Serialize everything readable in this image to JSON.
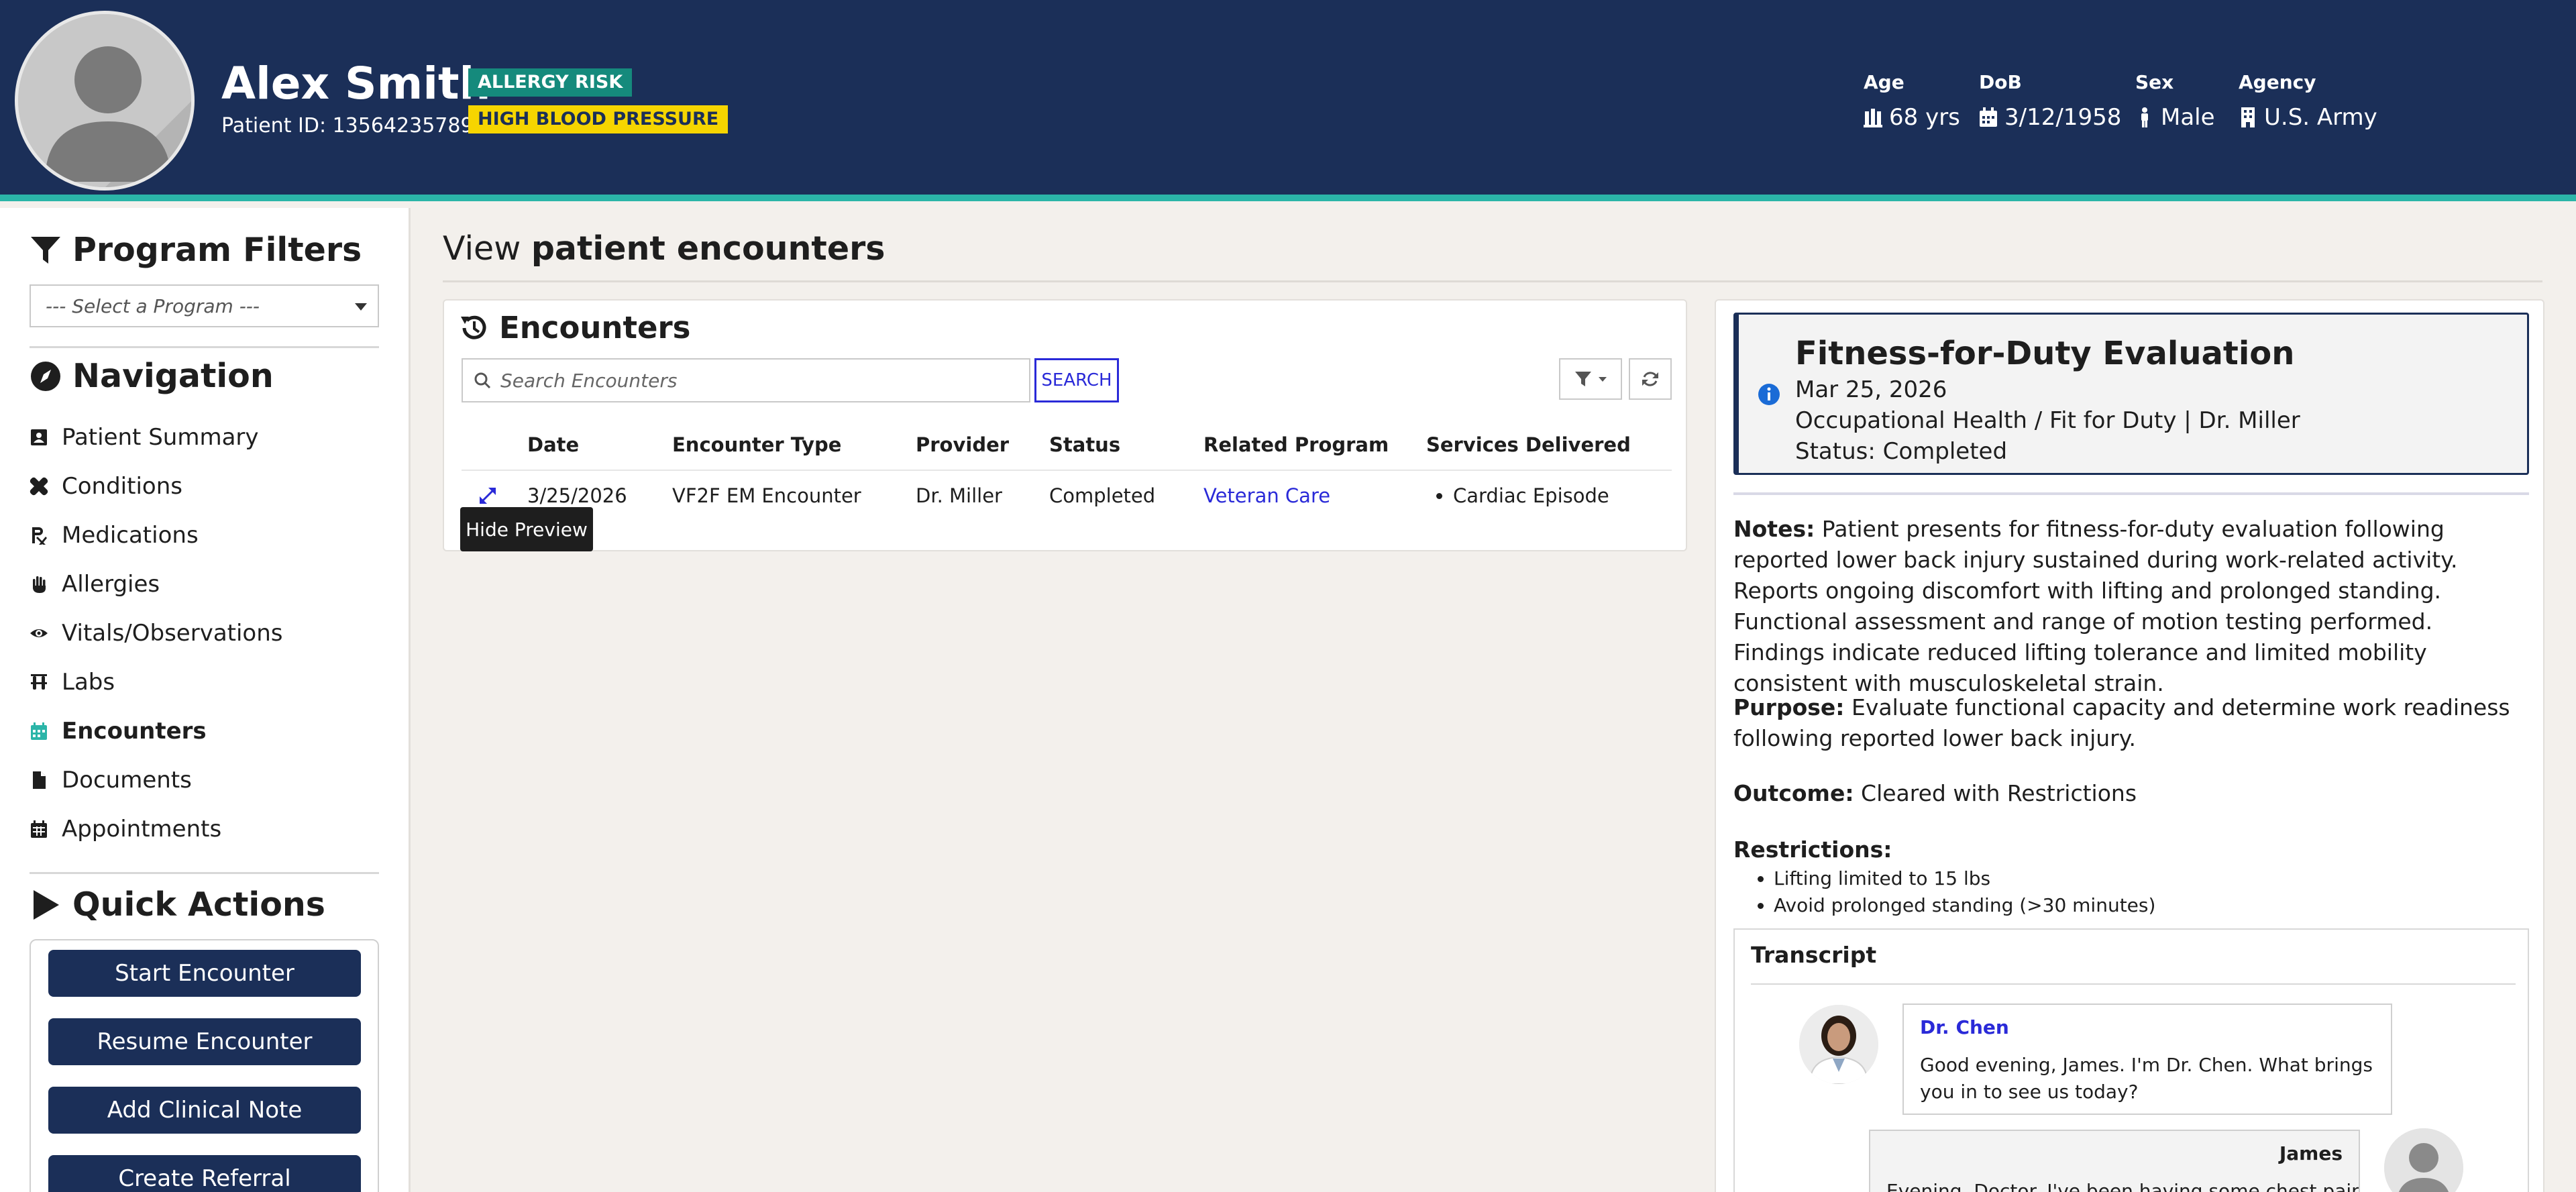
{
  "patient": {
    "name": "Alex Smith",
    "id_label": "Patient ID: 13564235789",
    "badges": [
      "ALLERGY RISK",
      "HIGH BLOOD PRESSURE"
    ],
    "demographics": [
      {
        "label": "Age",
        "value": "68 yrs",
        "icon": "person-group-icon"
      },
      {
        "label": "DoB",
        "value": "3/12/1958",
        "icon": "calendar-icon"
      },
      {
        "label": "Sex",
        "value": "Male",
        "icon": "male-icon"
      },
      {
        "label": "Agency",
        "value": "U.S. Army",
        "icon": "building-icon"
      }
    ]
  },
  "sidebar": {
    "program_filters_title": "Program Filters",
    "program_select_placeholder": "--- Select a Program ---",
    "navigation_title": "Navigation",
    "nav_items": [
      {
        "label": "Patient Summary",
        "icon": "id-card-icon"
      },
      {
        "label": "Conditions",
        "icon": "bandage-icon"
      },
      {
        "label": "Medications",
        "icon": "prescription-icon"
      },
      {
        "label": "Allergies",
        "icon": "hand-icon"
      },
      {
        "label": "Vitals/Observations",
        "icon": "eye-icon"
      },
      {
        "label": "Labs",
        "icon": "flask-icon"
      },
      {
        "label": "Encounters",
        "icon": "calendar-icon",
        "active": true
      },
      {
        "label": "Documents",
        "icon": "file-icon"
      },
      {
        "label": "Appointments",
        "icon": "calendar-grid-icon"
      }
    ],
    "quick_actions_title": "Quick Actions",
    "quick_actions": [
      "Start Encounter",
      "Resume Encounter",
      "Add Clinical Note",
      "Create Referral"
    ]
  },
  "main": {
    "title_prefix": "View ",
    "title_bold": "patient encounters",
    "encounters": {
      "title": "Encounters",
      "search_placeholder": "Search Encounters",
      "search_button": "SEARCH",
      "columns": [
        "Date",
        "Encounter Type",
        "Provider",
        "Status",
        "Related Program",
        "Services Delivered"
      ],
      "rows": [
        {
          "date": "3/25/2026",
          "type": "VF2F EM Encounter",
          "provider": "Dr. Miller",
          "status": "Completed",
          "program": "Veteran Care",
          "services": [
            "Cardiac Episode"
          ]
        }
      ],
      "tooltip": "Hide Preview"
    }
  },
  "preview": {
    "title": "Fitness-for-Duty Evaluation",
    "date": "Mar 25, 2026",
    "context": "Occupational Health / Fit for Duty | Dr. Miller",
    "status": "Status: Completed",
    "notes_label": "Notes:",
    "notes": "Patient presents for fitness-for-duty evaluation following reported lower back injury sustained during work-related activity. Reports ongoing discomfort with lifting and prolonged standing. Functional assessment and range of motion testing performed. Findings indicate reduced lifting tolerance and limited mobility consistent with musculoskeletal strain.",
    "purpose_label": "Purpose:",
    "purpose": "Evaluate functional capacity and determine work readiness following reported lower back injury.",
    "outcome_label": "Outcome:",
    "outcome": "Cleared with Restrictions",
    "restrictions_label": "Restrictions:",
    "restrictions": [
      "Lifting limited to 15 lbs",
      "Avoid prolonged standing (>30 minutes)"
    ],
    "transcript": {
      "title": "Transcript",
      "messages": [
        {
          "speaker": "Dr. Chen",
          "text": "Good evening, James. I'm Dr. Chen. What brings you in to see us today?"
        },
        {
          "speaker": "James",
          "text": "Evening, Doctor. I've been having some chest pain —"
        }
      ]
    }
  },
  "colors": {
    "header_bg": "#1b2f58",
    "accent_teal": "#2bb5a8",
    "badge_allergy": "#158a7c",
    "badge_bp": "#f6d500",
    "link_blue": "#2a2ad8"
  }
}
